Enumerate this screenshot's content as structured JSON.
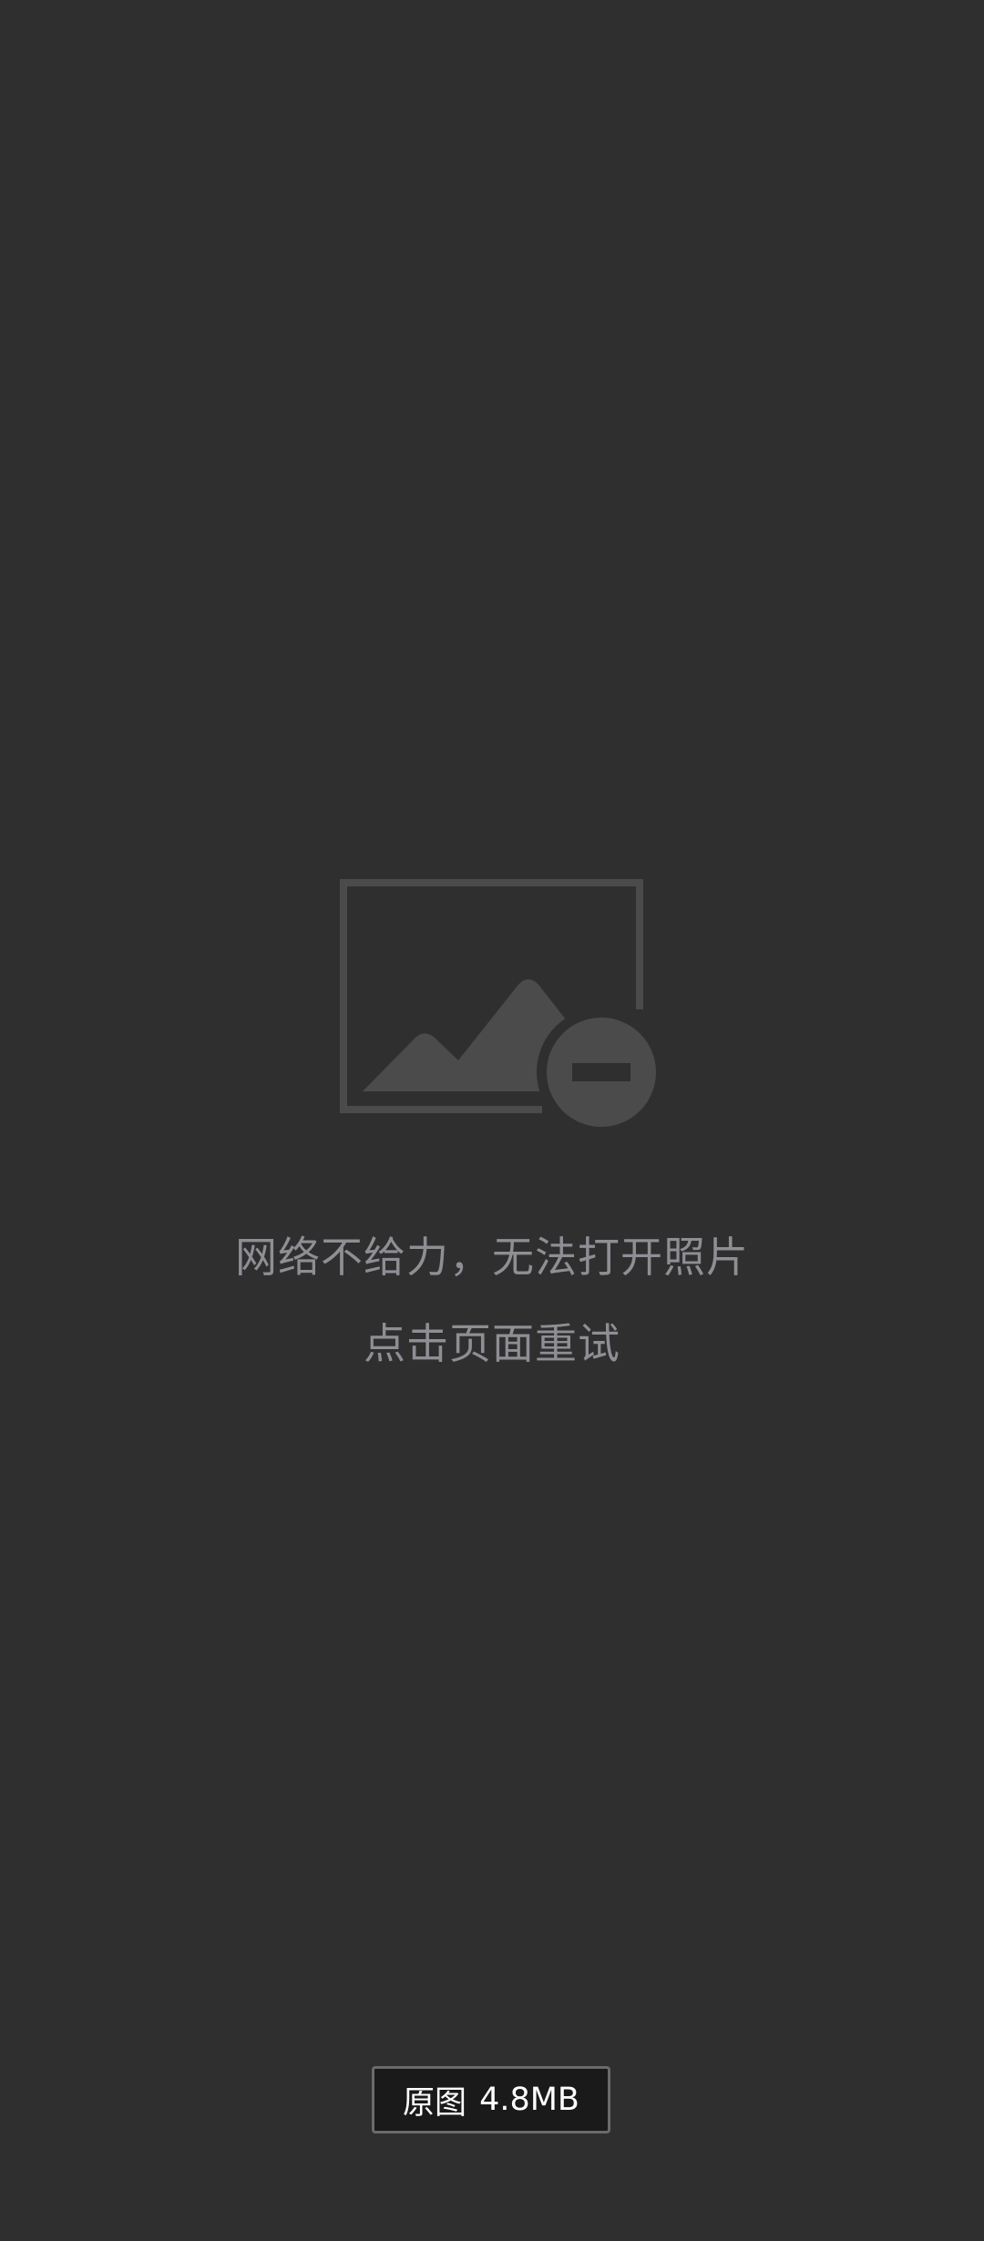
{
  "error": {
    "icon": "broken-image-icon",
    "line1": "网络不给力，无法打开照片",
    "line2": "点击页面重试"
  },
  "original_button": {
    "label": "原图",
    "size": "4.8MB"
  },
  "colors": {
    "background": "#2f2f2f",
    "icon": "#4b4b4b",
    "message_text": "#8e8e94",
    "button_bg": "#1a1a1a",
    "button_border": "#6a6a6a",
    "button_text": "#ffffff"
  }
}
